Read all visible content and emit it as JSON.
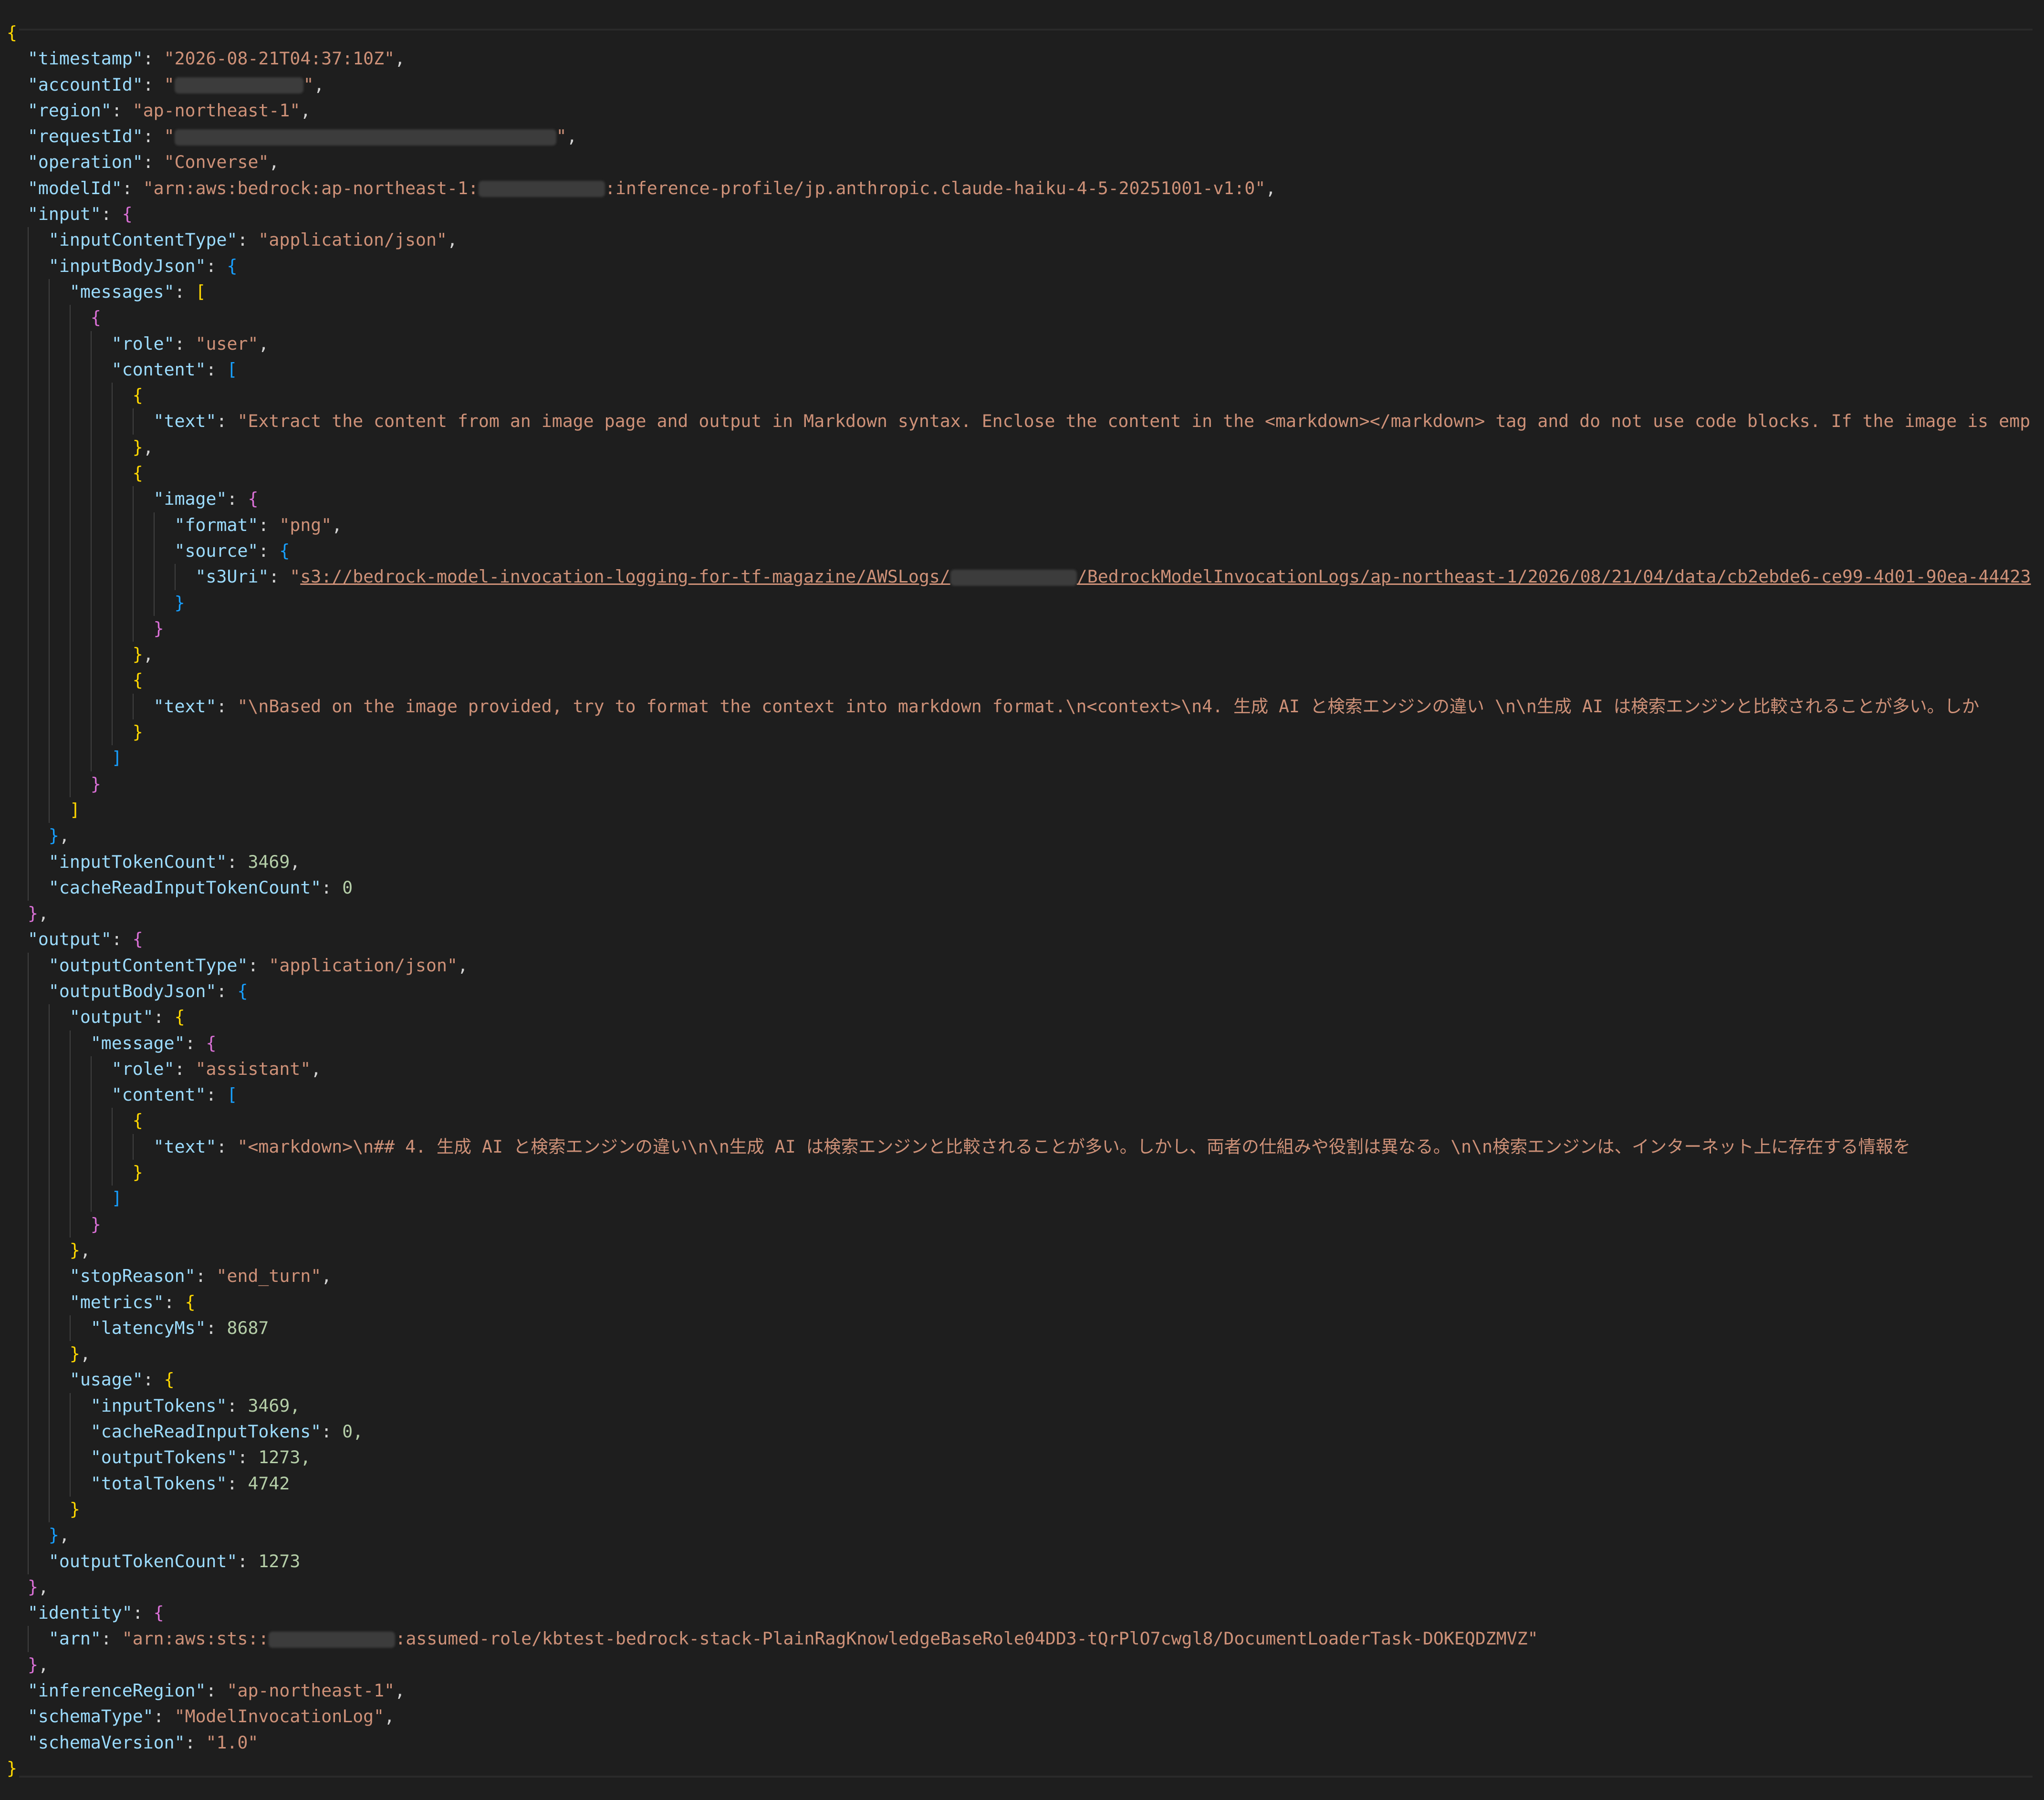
{
  "log": {
    "timestamp": "2026-08-21T04:37:10Z",
    "account_id_prefix": "",
    "region": "ap-northeast-1",
    "operation": "Converse",
    "model_id_prefix": "arn:aws:bedrock:ap-northeast-1:",
    "model_id_suffix": ":inference-profile/jp.anthropic.claude-haiku-4-5-20251001-v1:0",
    "input_content_type": "application/json",
    "role_user": "user",
    "prompt_text": "Extract the content from an image page and output in Markdown syntax. Enclose the content in the <markdown></markdown> tag and do not use code blocks. If the image is emp",
    "image_format": "png",
    "s3_uri_prefix": "s3://bedrock-model-invocation-logging-for-tf-magazine/AWSLogs/",
    "s3_uri_suffix": "/BedrockModelInvocationLogs/ap-northeast-1/2026/08/21/04/data/cb2ebde6-ce99-4d01-90ea-44423",
    "context_text": "\\nBased on the image provided, try to format the context into markdown format.\\n<context>\\n4. 生成 AI と検索エンジンの違い \\n\\n生成 AI は検索エンジンと比較されることが多い。しか",
    "input_token_count": "3469",
    "cache_read_input_token_count": "0",
    "output_content_type": "application/json",
    "role_assistant": "assistant",
    "output_text": "<markdown>\\n## 4. 生成 AI と検索エンジンの違い\\n\\n生成 AI は検索エンジンと比較されることが多い。しかし、両者の仕組みや役割は異なる。\\n\\n検索エンジンは、インターネット上に存在する情報を",
    "stop_reason": "end_turn",
    "latency_ms": "8687",
    "usage_input_tokens": "3469,",
    "usage_cache_read_input_tokens": "0,",
    "usage_output_tokens": "1273,",
    "usage_total_tokens": "4742",
    "output_token_count": "1273",
    "identity_arn_prefix": "arn:aws:sts::",
    "identity_arn_suffix": ":assumed-role/kbtest-bedrock-stack-PlainRagKnowledgeBaseRole04DD3-tQrPlO7cwgl8/DocumentLoaderTask-DOKEQDZMVZ\"",
    "inference_region": "ap-northeast-1",
    "schema_type": "ModelInvocationLog",
    "schema_version": "1.0"
  },
  "keys": {
    "timestamp": "\"timestamp\"",
    "accountId": "\"accountId\"",
    "region": "\"region\"",
    "requestId": "\"requestId\"",
    "operation": "\"operation\"",
    "modelId": "\"modelId\"",
    "input": "\"input\"",
    "inputContentType": "\"inputContentType\"",
    "inputBodyJson": "\"inputBodyJson\"",
    "messages": "\"messages\"",
    "role": "\"role\"",
    "content": "\"content\"",
    "text": "\"text\"",
    "image": "\"image\"",
    "format": "\"format\"",
    "source": "\"source\"",
    "s3Uri": "\"s3Uri\"",
    "inputTokenCount": "\"inputTokenCount\"",
    "cacheReadInputTokenCount": "\"cacheReadInputTokenCount\"",
    "output": "\"output\"",
    "outputContentType": "\"outputContentType\"",
    "outputBodyJson": "\"outputBodyJson\"",
    "message": "\"message\"",
    "stopReason": "\"stopReason\"",
    "metrics": "\"metrics\"",
    "latencyMs": "\"latencyMs\"",
    "usage": "\"usage\"",
    "inputTokens": "\"inputTokens\"",
    "cacheReadInputTokens": "\"cacheReadInputTokens\"",
    "outputTokens": "\"outputTokens\"",
    "totalTokens": "\"totalTokens\"",
    "outputTokenCount": "\"outputTokenCount\"",
    "identity": "\"identity\"",
    "arn": "\"arn\"",
    "inferenceRegion": "\"inferenceRegion\"",
    "schemaType": "\"schemaType\"",
    "schemaVersion": "\"schemaVersion\""
  },
  "colors": {
    "background": "#1e1e1e",
    "key": "#9cdcfe",
    "string": "#ce9178",
    "number": "#b5cea8",
    "bracket_level_1": "#ffd700",
    "bracket_level_2": "#da70d6",
    "bracket_level_3": "#179fff"
  }
}
